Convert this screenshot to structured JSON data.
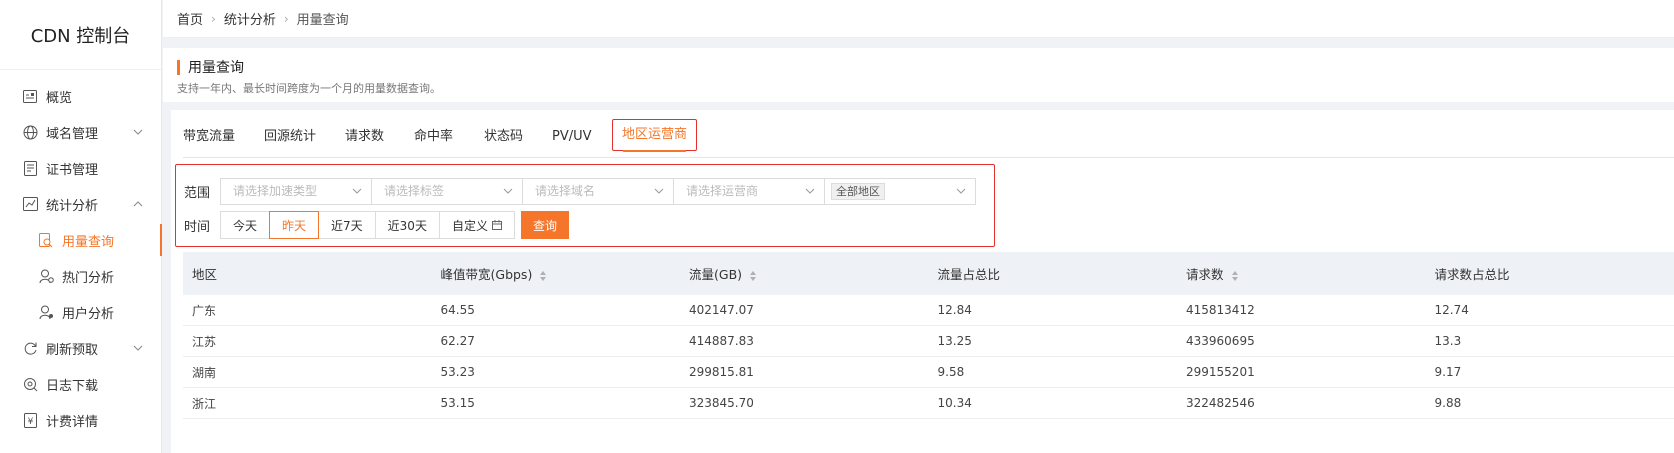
{
  "brand": "CDN 控制台",
  "sidebar": {
    "items": [
      {
        "label": "概览",
        "icon": "overview-icon"
      },
      {
        "label": "域名管理",
        "icon": "globe-icon",
        "expand": "down"
      },
      {
        "label": "证书管理",
        "icon": "certificate-icon"
      },
      {
        "label": "统计分析",
        "icon": "chart-icon",
        "expand": "up"
      },
      {
        "label": "用量查询",
        "icon": "usage-search-icon",
        "active": true,
        "sub": true
      },
      {
        "label": "热门分析",
        "icon": "hot-user-icon",
        "sub": true
      },
      {
        "label": "用户分析",
        "icon": "user-analysis-icon",
        "sub": true
      },
      {
        "label": "刷新预取",
        "icon": "refresh-icon",
        "expand": "down"
      },
      {
        "label": "日志下载",
        "icon": "log-download-icon"
      },
      {
        "label": "计费详情",
        "icon": "billing-icon"
      }
    ]
  },
  "breadcrumb": [
    "首页",
    "统计分析",
    "用量查询"
  ],
  "page": {
    "title": "用量查询",
    "subtitle": "支持一年内、最长时间跨度为一个月的用量数据查询。"
  },
  "tabs": [
    "带宽流量",
    "回源统计",
    "请求数",
    "命中率",
    "状态码",
    "PV/UV",
    "地区运营商"
  ],
  "active_tab": "地区运营商",
  "filters": {
    "scope_label": "范围",
    "time_label": "时间",
    "placeholders": {
      "accel_type": "请选择加速类型",
      "tag": "请选择标签",
      "domain": "请选择域名",
      "isp": "请选择运营商"
    },
    "region_tag": "全部地区",
    "time_options": [
      "今天",
      "昨天",
      "近7天",
      "近30天",
      "自定义"
    ],
    "active_time": "昨天",
    "query_button": "查询"
  },
  "table": {
    "columns": [
      "地区",
      "峰值带宽(Gbps)",
      "流量(GB)",
      "流量占总比",
      "请求数",
      "请求数占总比"
    ],
    "rows": [
      [
        "广东",
        "64.55",
        "402147.07",
        "12.84",
        "415813412",
        "12.74"
      ],
      [
        "江苏",
        "62.27",
        "414887.83",
        "13.25",
        "433960695",
        "13.3"
      ],
      [
        "湖南",
        "53.23",
        "299815.81",
        "9.58",
        "299155201",
        "9.17"
      ],
      [
        "浙江",
        "53.15",
        "323845.70",
        "10.34",
        "322482546",
        "9.88"
      ]
    ]
  },
  "colors": {
    "accent": "#f5762a",
    "highlight_border": "#e5312c",
    "table_header_bg": "#eef1f6"
  }
}
